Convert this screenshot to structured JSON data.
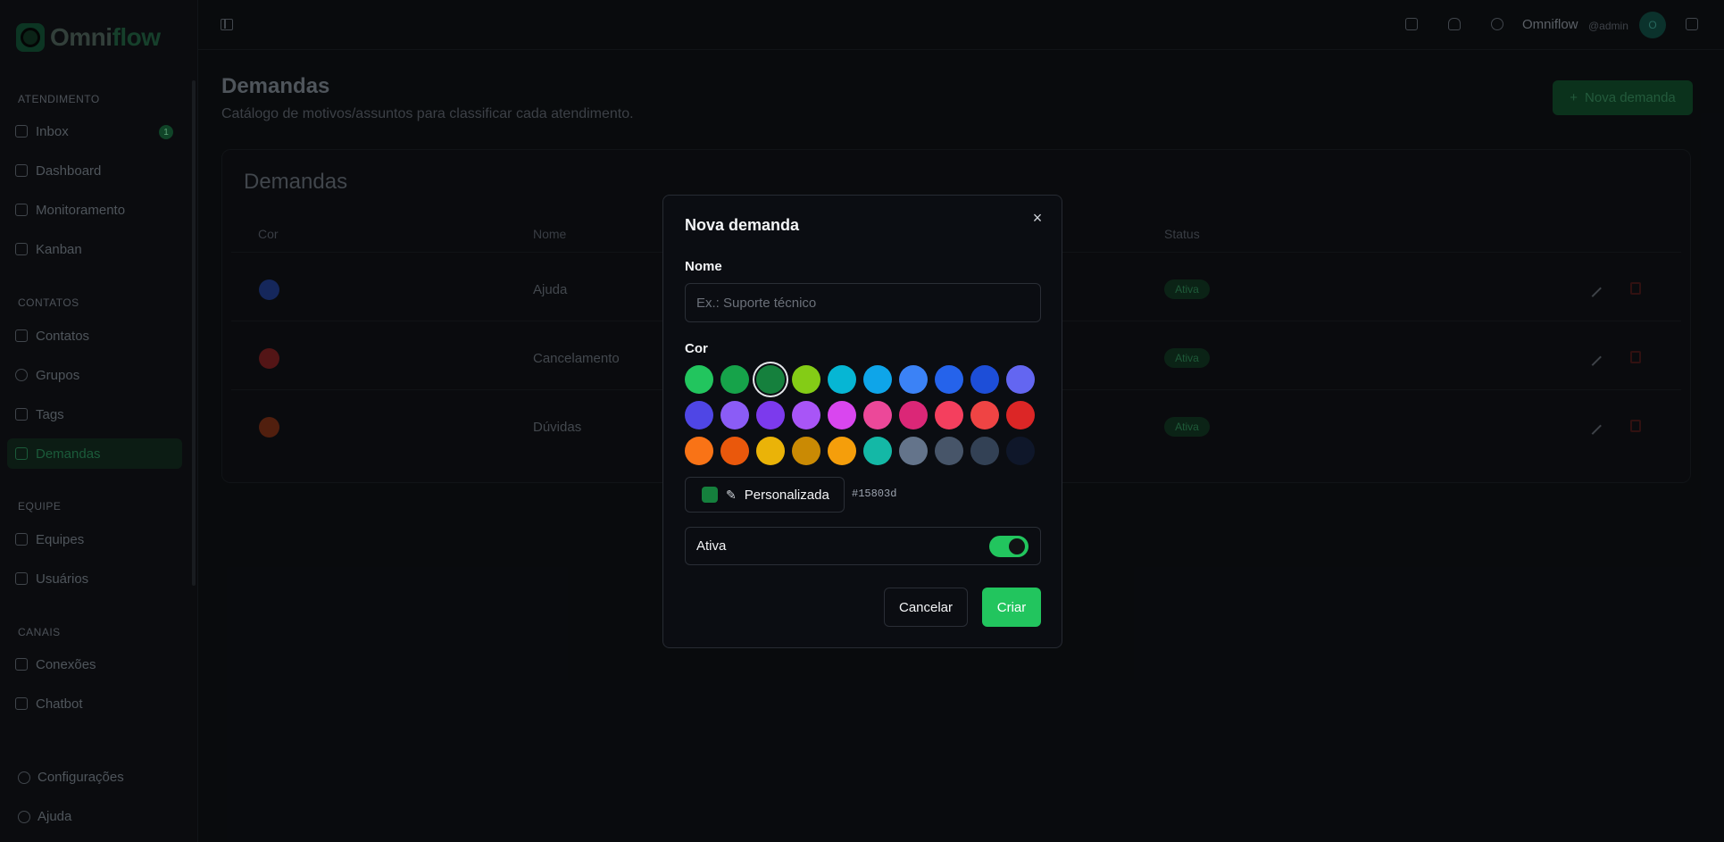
{
  "brand": {
    "logo_text_a": "Omni",
    "logo_text_b": "flow"
  },
  "sidebar": {
    "sections": [
      {
        "title": "ATENDIMENTO",
        "items": [
          {
            "label": "Inbox",
            "icon": "message-square-icon",
            "badge": "1"
          },
          {
            "label": "Dashboard",
            "icon": "layout-dashboard-icon"
          },
          {
            "label": "Monitoramento",
            "icon": "monitor-icon"
          },
          {
            "label": "Kanban",
            "icon": "kanban-icon"
          }
        ]
      },
      {
        "title": "CONTATOS",
        "items": [
          {
            "label": "Contatos",
            "icon": "contact-icon"
          },
          {
            "label": "Grupos",
            "icon": "message-circle-icon"
          },
          {
            "label": "Tags",
            "icon": "tag-icon"
          },
          {
            "label": "Demandas",
            "icon": "clipboard-icon",
            "active": true
          }
        ]
      },
      {
        "title": "EQUIPE",
        "items": [
          {
            "label": "Equipes",
            "icon": "users-icon"
          },
          {
            "label": "Usuários",
            "icon": "user-icon"
          }
        ]
      },
      {
        "title": "CANAIS",
        "items": [
          {
            "label": "Conexões",
            "icon": "plug-icon"
          },
          {
            "label": "Chatbot",
            "icon": "bot-icon"
          }
        ]
      }
    ],
    "footer": {
      "settings": "Configurações",
      "help": "Ajuda"
    }
  },
  "topbar": {
    "user_name": "Omniflow",
    "user_handle": "@admin",
    "avatar_initial": "O"
  },
  "page": {
    "title": "Demandas",
    "subtitle": "Catálogo de motivos/assuntos para classificar cada atendimento.",
    "new_button": "Nova demanda"
  },
  "table": {
    "title": "Demandas",
    "headers": {
      "color": "Cor",
      "name": "Nome",
      "status": "Status"
    },
    "rows": [
      {
        "color": "#1e3a8a",
        "name": "Ajuda",
        "status": "Ativa"
      },
      {
        "color": "#7f1d1d",
        "name": "Cancelamento",
        "status": "Ativa"
      },
      {
        "color": "#7c2d12",
        "name": "Dúvidas",
        "status": "Ativa"
      }
    ]
  },
  "modal": {
    "title": "Nova demanda",
    "close": "×",
    "name_label": "Nome",
    "name_value": "",
    "name_placeholder": "Ex.: Suporte técnico",
    "color_label": "Cor",
    "palette": [
      "#22c55e",
      "#16a34a",
      "#15803d",
      "#84cc16",
      "#06b6d4",
      "#0ea5e9",
      "#3b82f6",
      "#2563eb",
      "#1d4ed8",
      "#6366f1",
      "#4f46e5",
      "#8b5cf6",
      "#7c3aed",
      "#a855f7",
      "#d946ef",
      "#ec4899",
      "#db2777",
      "#f43f5e",
      "#ef4444",
      "#dc2626",
      "#f97316",
      "#ea580c",
      "#eab308",
      "#ca8a04",
      "#f59e0b",
      "#14b8a6",
      "#64748b",
      "#475569",
      "#334155",
      "#0f172a"
    ],
    "selected_color": "#15803d",
    "custom_label": "Personalizada",
    "custom_hex": "#15803d",
    "active_label": "Ativa",
    "active_on": true,
    "cancel_label": "Cancelar",
    "create_label": "Criar"
  }
}
